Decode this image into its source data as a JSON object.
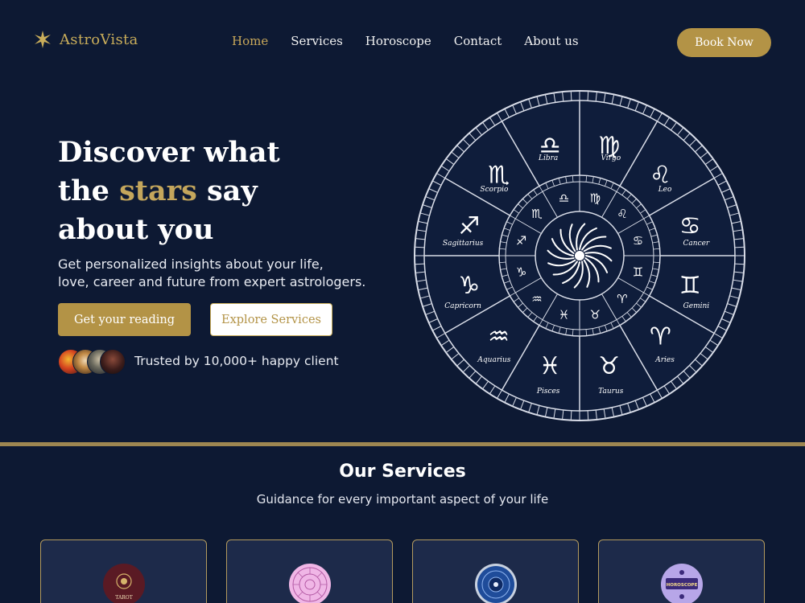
{
  "header": {
    "logo_text": "AstroVista",
    "nav": [
      "Home",
      "Services",
      "Horoscope",
      "Contact",
      "About us"
    ],
    "active_nav": "Home",
    "book_label": "Book Now"
  },
  "hero": {
    "title_part1": "Discover what",
    "title_part2a": "the ",
    "title_accent": "stars",
    "title_part2b": " say",
    "title_part3": "about you",
    "description_line1": "Get personalized insights about your life,",
    "description_line2": "love, career and future from expert astrologers.",
    "primary_label": "Get your reading",
    "secondary_label": "Explore Services",
    "trusted_text": "Trusted by 10,000+ happy client"
  },
  "wheel": {
    "signs": [
      "Libra",
      "Virgo",
      "Leo",
      "Cancer",
      "Gemini",
      "Aries",
      "Taurus",
      "Pisces",
      "Aquarius",
      "Capricorn",
      "Sagittarius",
      "Scorpio"
    ],
    "glyphs": [
      "♎",
      "♍",
      "♌",
      "♋",
      "♊",
      "♈",
      "♉",
      "♓",
      "♒",
      "♑",
      "♐",
      "♏"
    ]
  },
  "services": {
    "title": "Our Services",
    "subtitle": "Guidance for every important aspect of your life",
    "cards": [
      {
        "icon": "tarot-icon",
        "badge": "TAROT"
      },
      {
        "icon": "zodiac-chart-icon",
        "badge": ""
      },
      {
        "icon": "kundli-icon",
        "badge": ""
      },
      {
        "icon": "horoscope-icon",
        "badge": "HOROSCOPE"
      }
    ]
  },
  "colors": {
    "background": "#0d1933",
    "accent_gold": "#b39346",
    "card_bg": "#1d2a4a"
  }
}
